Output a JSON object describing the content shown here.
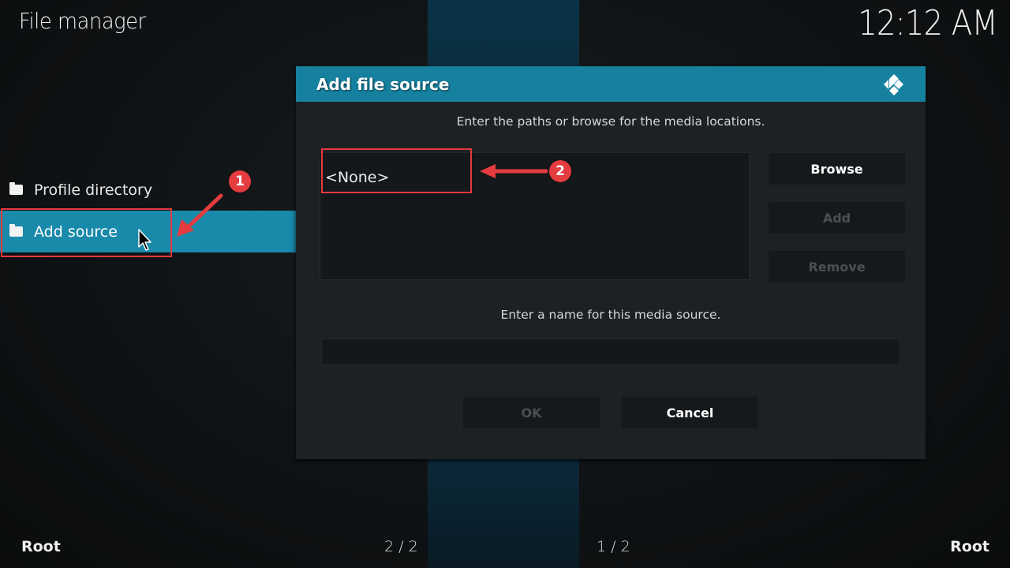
{
  "header": {
    "title": "File manager",
    "clock": "12:12 AM"
  },
  "file_list": {
    "items": [
      {
        "label": "Profile directory",
        "icon": "folder-icon",
        "selected": false
      },
      {
        "label": "Add source",
        "icon": "folder-icon",
        "selected": true
      }
    ]
  },
  "dialog": {
    "title": "Add file source",
    "logo_icon": "kodi-logo-icon",
    "paths_hint": "Enter the paths or browse for the media locations.",
    "paths": [
      "<None>"
    ],
    "buttons": {
      "browse": "Browse",
      "add": "Add",
      "remove": "Remove"
    },
    "name_hint": "Enter a name for this media source.",
    "name_value": "",
    "ok": "OK",
    "cancel": "Cancel"
  },
  "annotations": {
    "step1": "1",
    "step2": "2",
    "color": "#e53c40"
  },
  "footer": {
    "left_location": "Root",
    "left_page": "2 / 2",
    "right_page": "1 / 2",
    "right_location": "Root"
  },
  "colors": {
    "accent": "#16809f",
    "selected_item": "#1a8aab",
    "dialog_bg": "#1e2124",
    "background": "#0e1113"
  }
}
